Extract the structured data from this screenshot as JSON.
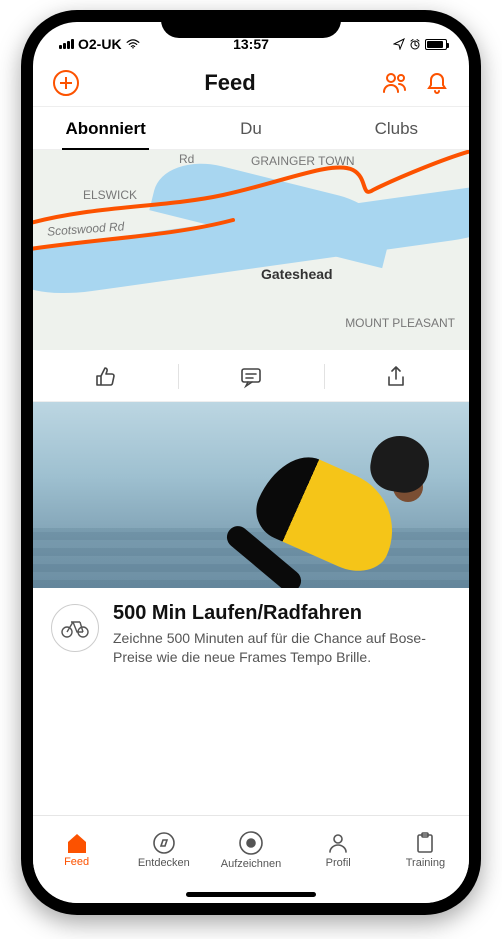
{
  "status": {
    "carrier": "O2-UK",
    "time": "13:57"
  },
  "header": {
    "title": "Feed"
  },
  "tabs": {
    "subscribed": "Abonniert",
    "you": "Du",
    "clubs": "Clubs",
    "active": "subscribed"
  },
  "map": {
    "labels": {
      "elswick": "ELSWICK",
      "scotswood": "Scotswood Rd",
      "grainger": "GRAINGER TOWN",
      "gateshead": "Gateshead",
      "mount": "MOUNT PLEASANT",
      "road_rd": "Rd"
    }
  },
  "promo": {
    "title": "500 Min Laufen/Radfahren",
    "body": "Zeichne 500 Minuten auf für die Chance auf Bose-Preise wie die neue Frames Tempo Brille."
  },
  "nav": {
    "feed": "Feed",
    "discover": "Entdecken",
    "record": "Aufzeichnen",
    "profile": "Profil",
    "training": "Training"
  }
}
